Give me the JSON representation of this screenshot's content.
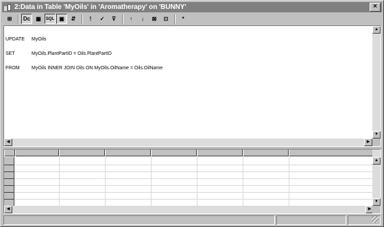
{
  "window": {
    "title": "2:Data in Table 'MyOils' in 'Aromatherapy' on 'BUNNY'",
    "close_label": "×"
  },
  "toolbar": {
    "buttons": [
      {
        "name": "properties-icon",
        "glyph": "⊞",
        "pressed": false
      },
      {
        "name": "show-diagram-pane-icon",
        "glyph": "Dc",
        "pressed": true
      },
      {
        "name": "show-grid-pane-icon",
        "glyph": "▦",
        "pressed": false
      },
      {
        "name": "show-sql-pane-icon",
        "glyph": "SQL",
        "pressed": true
      },
      {
        "name": "show-results-pane-icon",
        "glyph": "▣",
        "pressed": true
      },
      {
        "name": "change-query-type-icon",
        "glyph": "⇵",
        "pressed": false
      },
      {
        "name": "run-icon",
        "glyph": "!",
        "pressed": false
      },
      {
        "name": "verify-sql-icon",
        "glyph": "✓",
        "pressed": false
      },
      {
        "name": "remove-filter-icon",
        "glyph": "⊽",
        "pressed": false
      },
      {
        "name": "sort-ascending-icon",
        "glyph": "↑",
        "pressed": false
      },
      {
        "name": "sort-descending-icon",
        "glyph": "↓",
        "pressed": false
      },
      {
        "name": "use-group-by-icon",
        "glyph": "⊠",
        "pressed": false
      },
      {
        "name": "add-table-icon",
        "glyph": "⊡",
        "pressed": false
      },
      {
        "name": "new-row-icon",
        "glyph": "*",
        "pressed": false
      }
    ]
  },
  "sql": {
    "lines": [
      {
        "keyword": "UPDATE",
        "text": "MyOils"
      },
      {
        "keyword": "SET",
        "text": "MyOils.PlantPartID = Oils.PlantPartID"
      },
      {
        "keyword": "FROM",
        "text": "MyOils INNER JOIN Oils ON MyOils.OilName = Oils.OilName"
      }
    ]
  },
  "scroll": {
    "up_glyph": "▲",
    "down_glyph": "▼",
    "left_glyph": "◀",
    "right_glyph": "▶"
  }
}
